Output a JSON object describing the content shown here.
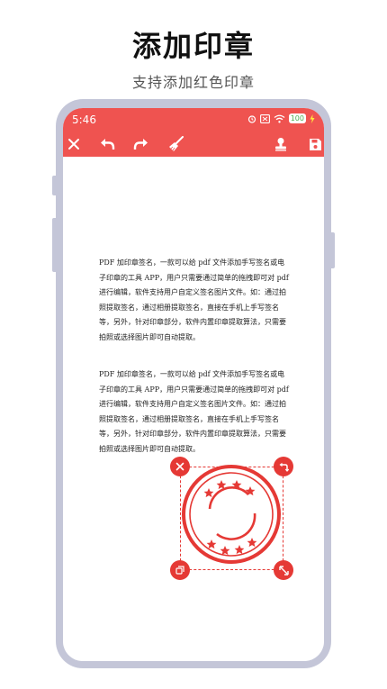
{
  "promo": {
    "headline": "添加印章",
    "subline": "支持添加红色印章"
  },
  "status_bar": {
    "time": "5:46",
    "battery": "100"
  },
  "toolbar": {
    "icons": [
      "close-icon",
      "undo-icon",
      "redo-icon",
      "broom-icon",
      "stamp-icon",
      "save-icon"
    ]
  },
  "document": {
    "paragraphs": [
      "PDF 加印章签名，一款可以给 pdf 文件添加手写签名或电子印章的工具 APP，用户只需要通过简单的拖拽即可对 pdf 进行编辑，软件支持用户自定义签名图片文件。如：通过拍照提取签名，通过相册提取签名，直接在手机上手写签名等，另外，针对印章部分，软件内置印章提取算法，只需要拍照或选择图片即可自动提取。",
      "PDF 加印章签名，一款可以给 pdf 文件添加手写签名或电子印章的工具 APP，用户只需要通过简单的拖拽即可对 pdf 进行编辑，软件支持用户自定义签名图片文件。如：通过拍照提取签名，通过相册提取签名，直接在手机上手写签名等，另外，针对印章部分，软件内置印章提取算法，只需要拍照或选择图片即可自动提取。"
    ]
  },
  "stamp": {
    "color": "#e53935",
    "handles": [
      "delete-icon",
      "rotate-icon",
      "copy-icon",
      "resize-icon"
    ]
  },
  "colors": {
    "accent": "#ef5350",
    "phone_frame": "#c4c6d8"
  }
}
